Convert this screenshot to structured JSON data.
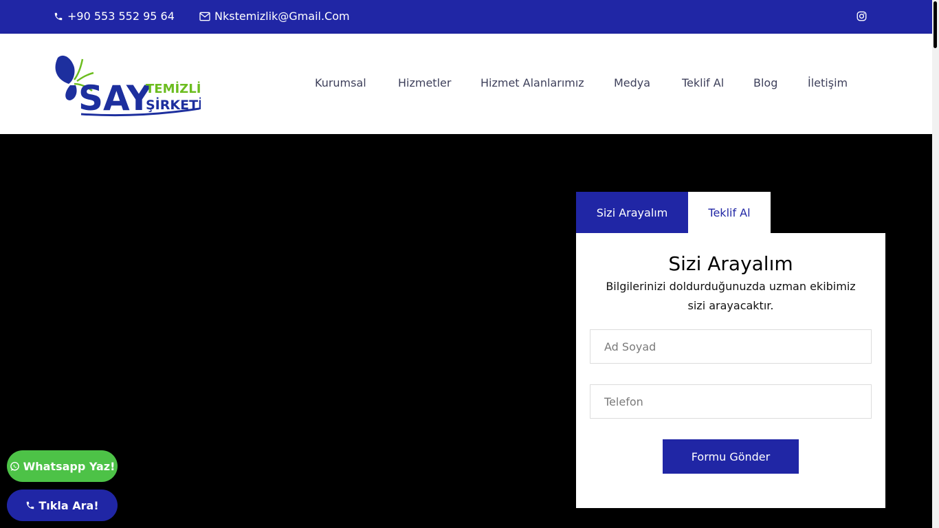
{
  "topbar": {
    "phone": "+90 553 552 95 64",
    "email": "Nkstemizlik@Gmail.Com"
  },
  "logo": {
    "brand": "SAY",
    "line1": "TEMİZLİK",
    "line2": "ŞİRKETİ"
  },
  "nav": {
    "items": [
      "Kurumsal",
      "Hizmetler",
      "Hizmet Alanlarımız",
      "Medya",
      "Teklif Al",
      "Blog",
      "İletişim"
    ]
  },
  "form": {
    "tab_active": "Sizi Arayalım",
    "tab_other": "Teklif Al",
    "title": "Sizi Arayalım",
    "description": "Bilgilerinizi doldurduğunuzda uzman ekibimiz sizi arayacaktır.",
    "name_placeholder": "Ad Soyad",
    "phone_placeholder": "Telefon",
    "submit_label": "Formu Gönder"
  },
  "floating": {
    "whatsapp_label": "Whatsapp Yaz!",
    "call_label": "Tıkla Ara!"
  },
  "colors": {
    "primary": "#2026a5",
    "whatsapp": "#4dc247",
    "logo_green": "#6cbd1f"
  }
}
